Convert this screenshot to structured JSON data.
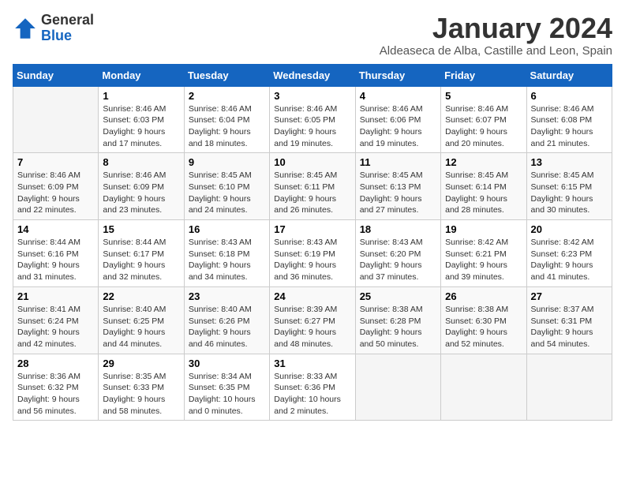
{
  "header": {
    "logo_general": "General",
    "logo_blue": "Blue",
    "month_title": "January 2024",
    "subtitle": "Aldeaseca de Alba, Castille and Leon, Spain"
  },
  "calendar": {
    "days_of_week": [
      "Sunday",
      "Monday",
      "Tuesday",
      "Wednesday",
      "Thursday",
      "Friday",
      "Saturday"
    ],
    "weeks": [
      [
        {
          "day": "",
          "info": ""
        },
        {
          "day": "1",
          "info": "Sunrise: 8:46 AM\nSunset: 6:03 PM\nDaylight: 9 hours\nand 17 minutes."
        },
        {
          "day": "2",
          "info": "Sunrise: 8:46 AM\nSunset: 6:04 PM\nDaylight: 9 hours\nand 18 minutes."
        },
        {
          "day": "3",
          "info": "Sunrise: 8:46 AM\nSunset: 6:05 PM\nDaylight: 9 hours\nand 19 minutes."
        },
        {
          "day": "4",
          "info": "Sunrise: 8:46 AM\nSunset: 6:06 PM\nDaylight: 9 hours\nand 19 minutes."
        },
        {
          "day": "5",
          "info": "Sunrise: 8:46 AM\nSunset: 6:07 PM\nDaylight: 9 hours\nand 20 minutes."
        },
        {
          "day": "6",
          "info": "Sunrise: 8:46 AM\nSunset: 6:08 PM\nDaylight: 9 hours\nand 21 minutes."
        }
      ],
      [
        {
          "day": "7",
          "info": "Sunrise: 8:46 AM\nSunset: 6:09 PM\nDaylight: 9 hours\nand 22 minutes."
        },
        {
          "day": "8",
          "info": "Sunrise: 8:46 AM\nSunset: 6:09 PM\nDaylight: 9 hours\nand 23 minutes."
        },
        {
          "day": "9",
          "info": "Sunrise: 8:45 AM\nSunset: 6:10 PM\nDaylight: 9 hours\nand 24 minutes."
        },
        {
          "day": "10",
          "info": "Sunrise: 8:45 AM\nSunset: 6:11 PM\nDaylight: 9 hours\nand 26 minutes."
        },
        {
          "day": "11",
          "info": "Sunrise: 8:45 AM\nSunset: 6:13 PM\nDaylight: 9 hours\nand 27 minutes."
        },
        {
          "day": "12",
          "info": "Sunrise: 8:45 AM\nSunset: 6:14 PM\nDaylight: 9 hours\nand 28 minutes."
        },
        {
          "day": "13",
          "info": "Sunrise: 8:45 AM\nSunset: 6:15 PM\nDaylight: 9 hours\nand 30 minutes."
        }
      ],
      [
        {
          "day": "14",
          "info": "Sunrise: 8:44 AM\nSunset: 6:16 PM\nDaylight: 9 hours\nand 31 minutes."
        },
        {
          "day": "15",
          "info": "Sunrise: 8:44 AM\nSunset: 6:17 PM\nDaylight: 9 hours\nand 32 minutes."
        },
        {
          "day": "16",
          "info": "Sunrise: 8:43 AM\nSunset: 6:18 PM\nDaylight: 9 hours\nand 34 minutes."
        },
        {
          "day": "17",
          "info": "Sunrise: 8:43 AM\nSunset: 6:19 PM\nDaylight: 9 hours\nand 36 minutes."
        },
        {
          "day": "18",
          "info": "Sunrise: 8:43 AM\nSunset: 6:20 PM\nDaylight: 9 hours\nand 37 minutes."
        },
        {
          "day": "19",
          "info": "Sunrise: 8:42 AM\nSunset: 6:21 PM\nDaylight: 9 hours\nand 39 minutes."
        },
        {
          "day": "20",
          "info": "Sunrise: 8:42 AM\nSunset: 6:23 PM\nDaylight: 9 hours\nand 41 minutes."
        }
      ],
      [
        {
          "day": "21",
          "info": "Sunrise: 8:41 AM\nSunset: 6:24 PM\nDaylight: 9 hours\nand 42 minutes."
        },
        {
          "day": "22",
          "info": "Sunrise: 8:40 AM\nSunset: 6:25 PM\nDaylight: 9 hours\nand 44 minutes."
        },
        {
          "day": "23",
          "info": "Sunrise: 8:40 AM\nSunset: 6:26 PM\nDaylight: 9 hours\nand 46 minutes."
        },
        {
          "day": "24",
          "info": "Sunrise: 8:39 AM\nSunset: 6:27 PM\nDaylight: 9 hours\nand 48 minutes."
        },
        {
          "day": "25",
          "info": "Sunrise: 8:38 AM\nSunset: 6:28 PM\nDaylight: 9 hours\nand 50 minutes."
        },
        {
          "day": "26",
          "info": "Sunrise: 8:38 AM\nSunset: 6:30 PM\nDaylight: 9 hours\nand 52 minutes."
        },
        {
          "day": "27",
          "info": "Sunrise: 8:37 AM\nSunset: 6:31 PM\nDaylight: 9 hours\nand 54 minutes."
        }
      ],
      [
        {
          "day": "28",
          "info": "Sunrise: 8:36 AM\nSunset: 6:32 PM\nDaylight: 9 hours\nand 56 minutes."
        },
        {
          "day": "29",
          "info": "Sunrise: 8:35 AM\nSunset: 6:33 PM\nDaylight: 9 hours\nand 58 minutes."
        },
        {
          "day": "30",
          "info": "Sunrise: 8:34 AM\nSunset: 6:35 PM\nDaylight: 10 hours\nand 0 minutes."
        },
        {
          "day": "31",
          "info": "Sunrise: 8:33 AM\nSunset: 6:36 PM\nDaylight: 10 hours\nand 2 minutes."
        },
        {
          "day": "",
          "info": ""
        },
        {
          "day": "",
          "info": ""
        },
        {
          "day": "",
          "info": ""
        }
      ]
    ]
  }
}
